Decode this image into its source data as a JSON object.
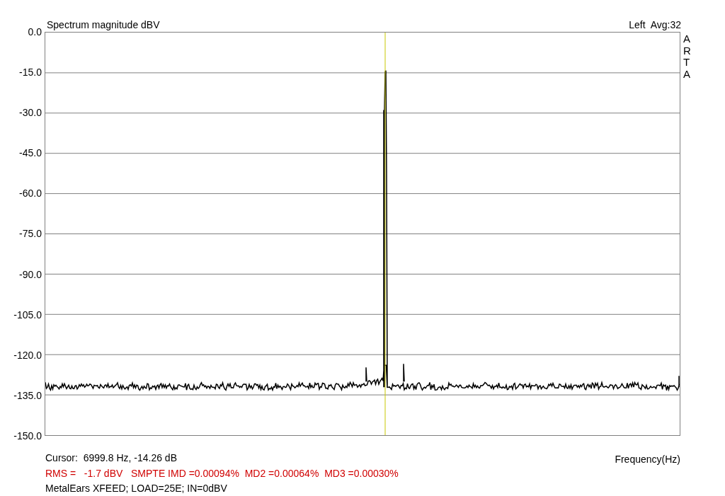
{
  "plot": {
    "title": "Spectrum magnitude dBV",
    "channel": "Left  Avg:32",
    "logo": "ARTA",
    "y_ticks": [
      "0.0",
      "-15.0",
      "-30.0",
      "-45.0",
      "-60.0",
      "-75.0",
      "-90.0",
      "-105.0",
      "-120.0",
      "-135.0",
      "-150.0"
    ],
    "x_label": "Frequency(Hz)"
  },
  "footer": {
    "cursor": "Cursor:  6999.8 Hz, -14.26 dB",
    "stats": "RMS =   -1.7 dBV   SMPTE IMD =0.00094%  MD2 =0.00064%  MD3 =0.00030%",
    "note": "MetalEars XFEED; LOAD=25E; IN=0dBV"
  }
}
